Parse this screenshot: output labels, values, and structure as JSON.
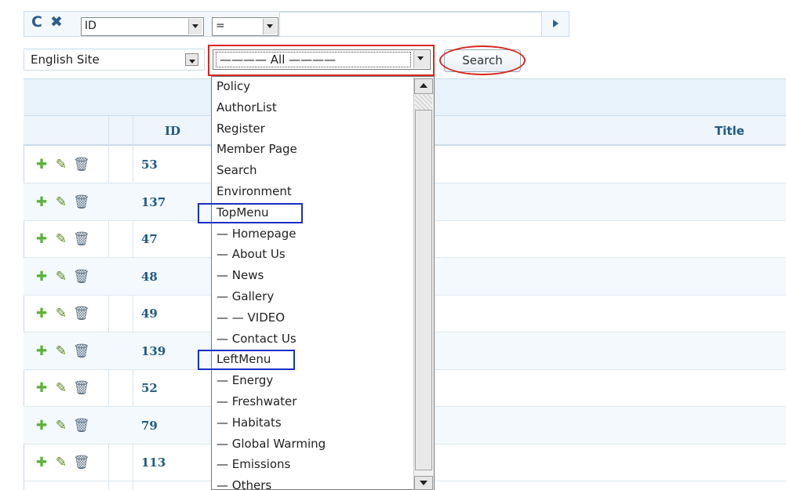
{
  "filter": {
    "refresh_icon": "refresh-icon",
    "close_icon": "close-icon",
    "field_value": "ID",
    "operator_value": "=",
    "value_input": ""
  },
  "site_select": {
    "value": "English Site"
  },
  "menu_select": {
    "value": "———— All ————"
  },
  "search_button": "Search",
  "grid": {
    "header": {
      "id": "ID",
      "title": "Title"
    },
    "rows": [
      {
        "id": "53"
      },
      {
        "id": "137"
      },
      {
        "id": "47"
      },
      {
        "id": "48"
      },
      {
        "id": "49"
      },
      {
        "id": "139"
      },
      {
        "id": "52"
      },
      {
        "id": "79"
      },
      {
        "id": "113"
      }
    ]
  },
  "dropdown": {
    "items": [
      "Policy",
      "AuthorList",
      "Register",
      "Member Page",
      "Search",
      "Environment",
      "TopMenu",
      "— Homepage",
      "— About Us",
      "— News",
      "— Gallery",
      "— — VIDEO",
      "— Contact Us",
      "LeftMenu",
      "— Energy",
      "— Freshwater",
      "— Habitats",
      "— Global Warming",
      "— Emissions",
      "— Others"
    ]
  },
  "colors": {
    "highlight_red": "#d9261c",
    "highlight_blue": "#1a2fc4",
    "link_blue": "#1f5a85"
  }
}
